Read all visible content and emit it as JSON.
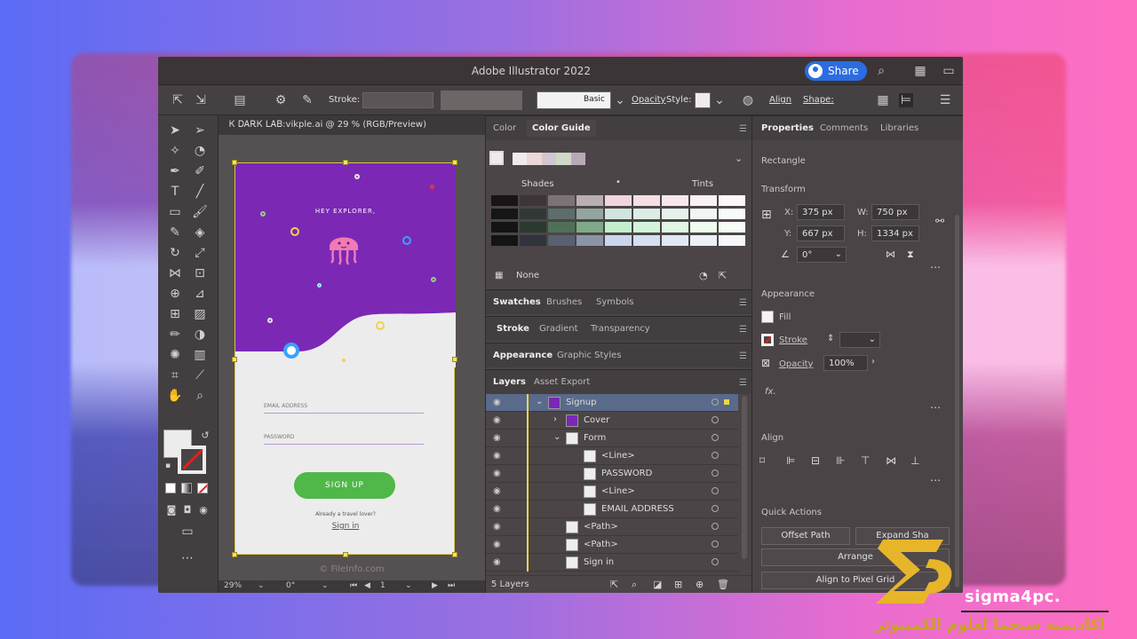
{
  "window": {
    "title": "Adobe Illustrator 2022",
    "share_label": "Share"
  },
  "toolbar": {
    "stroke_label": "Stroke:",
    "brush_style": "Basic",
    "opacity_label": "Opacity",
    "style_label": "Style:",
    "align_label": "Align",
    "shape_label": "Shape:"
  },
  "document": {
    "tab_title": "Ꮶ ᎠᎪᎡᏦ ᏞᎪᏴ:vikple.ai @ 29 % (RGB/Preview)",
    "artboard": {
      "greeting": "HEY EXPLORER,",
      "email_label": "EMAIL ADDRESS",
      "password_label": "PASSWORD",
      "signup_button": "SIGN UP",
      "already_text": "Already a travel lover?",
      "signin_link": "Sign in",
      "watermark": "© FileInfo.com"
    },
    "status": {
      "zoom": "29%",
      "rotation": "0°",
      "page": "1"
    }
  },
  "color_panel": {
    "tabs": [
      "Color",
      "Color Guide"
    ],
    "shades_label": "Shades",
    "tints_label": "Tints",
    "none_label": "None",
    "top_swatches": [
      "#f2eaea",
      "#e9d8d6",
      "#d3c6d2",
      "#cfd9c6",
      "#b9a9b7"
    ],
    "grid_colors": [
      [
        "#1a1416",
        "#3d3537",
        "#7c7375",
        "#b9aeb0",
        "#f0d5dc",
        "#f5dfe3",
        "#f8e8eb",
        "#fbf1f3",
        "#fdf7f8"
      ],
      [
        "#151617",
        "#303837",
        "#5d6d69",
        "#93a59f",
        "#d0e6dc",
        "#dbede5",
        "#e6f2ec",
        "#eff7f3",
        "#f7fbf9"
      ],
      [
        "#121513",
        "#2a3a30",
        "#4f7058",
        "#80a98a",
        "#c3f0cc",
        "#d2f4d8",
        "#e0f7e4",
        "#edfbf0",
        "#f6fdf7"
      ],
      [
        "#141416",
        "#30343d",
        "#586071",
        "#8a94a7",
        "#cbd6ec",
        "#d6def0",
        "#e1e7f4",
        "#ecf0f8",
        "#f5f7fc"
      ]
    ]
  },
  "panel_groups": [
    {
      "tabs": [
        "Swatches",
        "Brushes",
        "Symbols"
      ]
    },
    {
      "tabs": [
        "Stroke",
        "Gradient",
        "Transparency"
      ]
    },
    {
      "tabs": [
        "Appearance",
        "Graphic Styles"
      ]
    },
    {
      "tabs": [
        "Layers",
        "Asset Export"
      ]
    }
  ],
  "layers": {
    "rows": [
      {
        "name": "Signup",
        "indent": 0,
        "thumb": "#7b28b5",
        "expand": "⌄"
      },
      {
        "name": "Cover",
        "indent": 1,
        "thumb": "#7b28b5",
        "expand": "›"
      },
      {
        "name": "Form",
        "indent": 1,
        "thumb": "#eeeeee",
        "expand": "⌄"
      },
      {
        "name": "<Line>",
        "indent": 2,
        "thumb": "#eeeeee",
        "expand": ""
      },
      {
        "name": "PASSWORD",
        "indent": 2,
        "thumb": "#eeeeee",
        "expand": ""
      },
      {
        "name": "<Line>",
        "indent": 2,
        "thumb": "#eeeeee",
        "expand": ""
      },
      {
        "name": "EMAIL ADDRESS",
        "indent": 2,
        "thumb": "#eeeeee",
        "expand": ""
      },
      {
        "name": "<Path>",
        "indent": 1,
        "thumb": "#eeeeee",
        "expand": ""
      },
      {
        "name": "<Path>",
        "indent": 1,
        "thumb": "#eeeeee",
        "expand": ""
      },
      {
        "name": "Sign in",
        "indent": 1,
        "thumb": "#eeeeee",
        "expand": ""
      }
    ],
    "count_label": "5 Layers"
  },
  "properties": {
    "tabs": [
      "Properties",
      "Comments",
      "Libraries"
    ],
    "object_type": "Rectangle",
    "transform_label": "Transform",
    "x_label": "X:",
    "x_value": "375 px",
    "y_label": "Y:",
    "y_value": "667 px",
    "w_label": "W:",
    "w_value": "750 px",
    "h_label": "H:",
    "h_value": "1334 px",
    "angle_value": "0°",
    "appearance_label": "Appearance",
    "fill_label": "Fill",
    "stroke_label": "Stroke",
    "opacity_label": "Opacity",
    "opacity_value": "100%",
    "fx_label": "fx.",
    "align_label": "Align",
    "quick_actions_label": "Quick Actions",
    "offset_path_label": "Offset Path",
    "expand_shape_label": "Expand Sha",
    "arrange_label": "Arrange",
    "align_pixel_label": "Align to Pixel Grid"
  },
  "branding": {
    "site": "sigma4pc.",
    "arabic": "اكاديمية سيجما لعلوم الكمبيوتر",
    "gold": "#e7b52a"
  }
}
